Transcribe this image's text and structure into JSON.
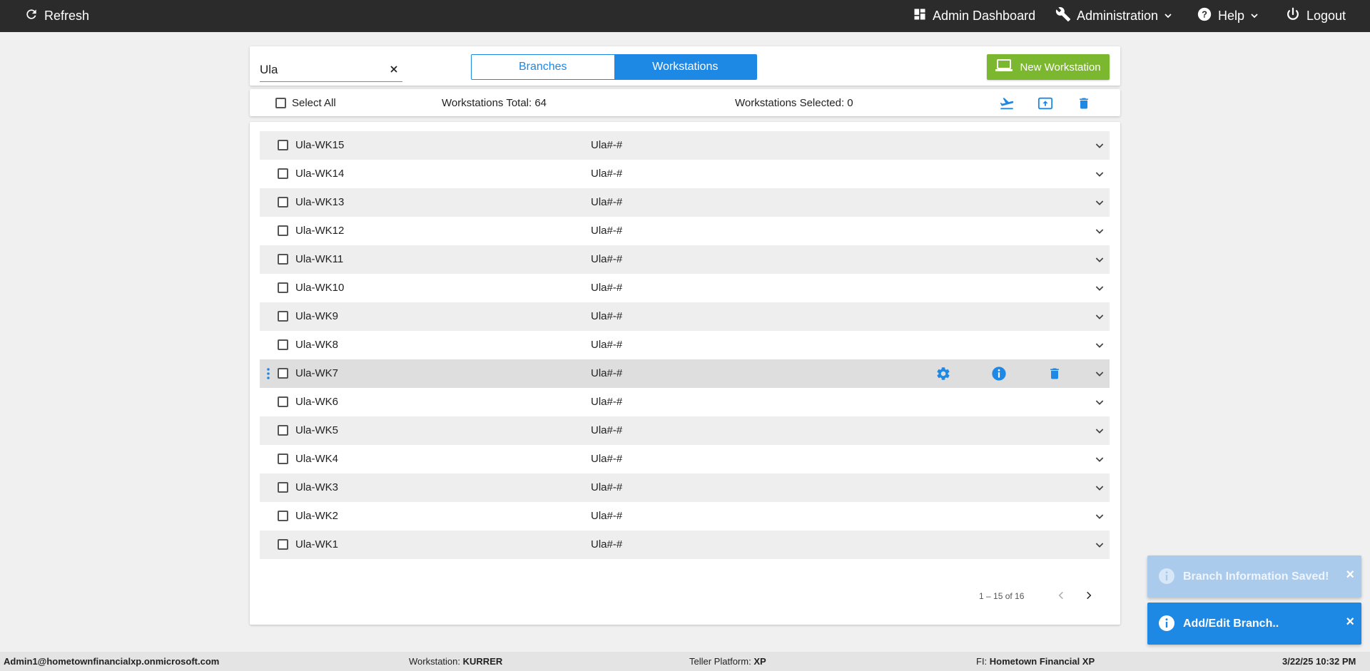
{
  "topbar": {
    "refresh_label": "Refresh",
    "dashboard_label": "Admin Dashboard",
    "administration_label": "Administration",
    "help_label": "Help",
    "logout_label": "Logout"
  },
  "toolbar": {
    "search_value": "Ula",
    "toggle": {
      "branches_label": "Branches",
      "workstations_label": "Workstations",
      "active": "workstations"
    },
    "new_workstation_label": "New Workstation"
  },
  "summary": {
    "select_all_label": "Select All",
    "total_label": "Workstations Total: 64",
    "selected_label": "Workstations Selected: 0"
  },
  "workstations": [
    {
      "name": "Ula-WK15",
      "code": "Ula#-#"
    },
    {
      "name": "Ula-WK14",
      "code": "Ula#-#"
    },
    {
      "name": "Ula-WK13",
      "code": "Ula#-#"
    },
    {
      "name": "Ula-WK12",
      "code": "Ula#-#"
    },
    {
      "name": "Ula-WK11",
      "code": "Ula#-#"
    },
    {
      "name": "Ula-WK10",
      "code": "Ula#-#"
    },
    {
      "name": "Ula-WK9",
      "code": "Ula#-#"
    },
    {
      "name": "Ula-WK8",
      "code": "Ula#-#"
    },
    {
      "name": "Ula-WK7",
      "code": "Ula#-#"
    },
    {
      "name": "Ula-WK6",
      "code": "Ula#-#"
    },
    {
      "name": "Ula-WK5",
      "code": "Ula#-#"
    },
    {
      "name": "Ula-WK4",
      "code": "Ula#-#"
    },
    {
      "name": "Ula-WK3",
      "code": "Ula#-#"
    },
    {
      "name": "Ula-WK2",
      "code": "Ula#-#"
    },
    {
      "name": "Ula-WK1",
      "code": "Ula#-#"
    }
  ],
  "pagination": {
    "range_label": "1 – 15 of 16"
  },
  "toasts": {
    "saved_message": "Branch Information Saved!",
    "saved_close": "×",
    "editing_message": "Add/Edit Branch..",
    "editing_close": "×"
  },
  "footer": {
    "user": "Admin1@hometownfinancialxp.onmicrosoft.com",
    "workstation_label": "Workstation:",
    "workstation_value": "KURRER",
    "platform_label": "Teller Platform:",
    "platform_value": "XP",
    "fi_label": "FI:",
    "fi_value": "Hometown Financial XP",
    "datetime": "3/22/25 10:32 PM"
  },
  "colors": {
    "topbar": "#2b2b2b",
    "accent_blue": "#1e88e5",
    "new_button_green": "#7cb82f",
    "toast_info": "#1e88e5"
  },
  "icons": {
    "refresh": "refresh-icon",
    "dashboard": "dashboard-icon",
    "administration": "wrench-icon",
    "help": "help-icon",
    "logout": "power-icon",
    "new_workstation": "laptop-icon",
    "summary_actions": [
      "flight-takeoff-icon",
      "upload-icon",
      "delete-icon"
    ],
    "row_actions": [
      "settings-icon",
      "info-icon",
      "delete-icon"
    ]
  }
}
